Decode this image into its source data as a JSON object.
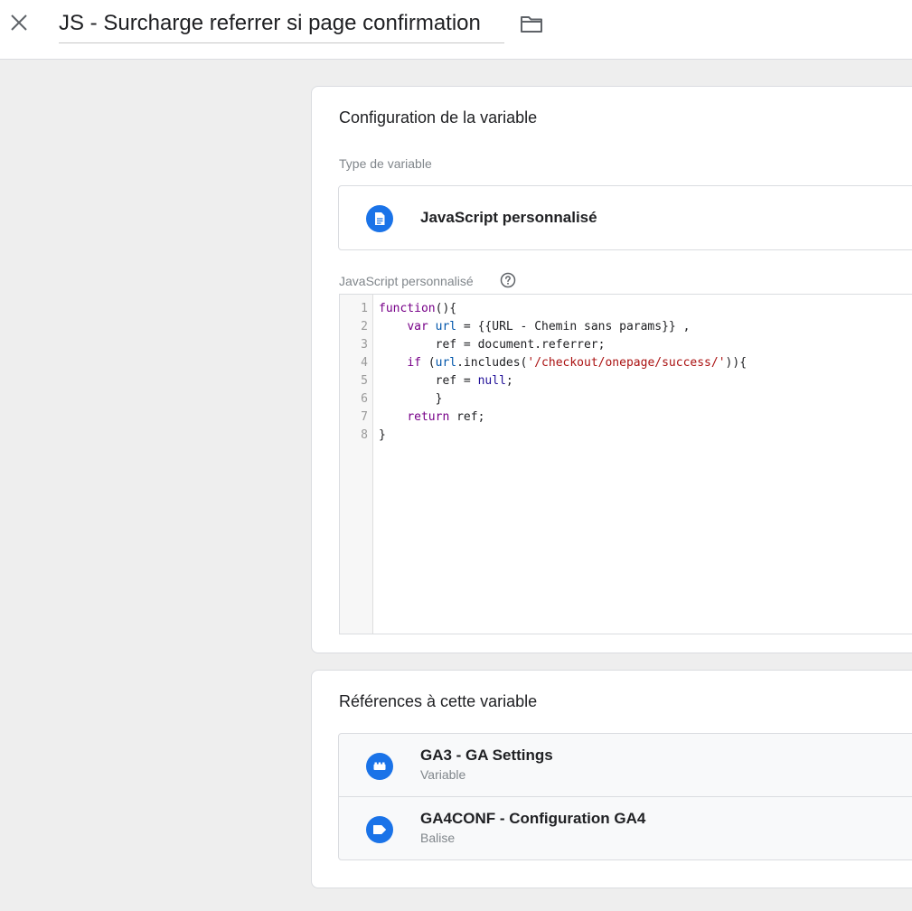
{
  "header": {
    "title": "JS - Surcharge referrer si page confirmation"
  },
  "config": {
    "heading": "Configuration de la variable",
    "type_label": "Type de variable",
    "type_value": "JavaScript personnalisé",
    "code_label": "JavaScript personnalisé",
    "line_numbers": [
      "1",
      "2",
      "3",
      "4",
      "5",
      "6",
      "7",
      "8"
    ],
    "code": {
      "l1": {
        "fn": "function",
        "rest": "(){"
      },
      "l2": {
        "indent": "    ",
        "kw": "var",
        "sp": " ",
        "var": "url",
        "rest": " = {{URL - Chemin sans params}} ,"
      },
      "l3": {
        "indent": "        ",
        "rest": "ref = document.referrer;"
      },
      "l4": {
        "indent": "    ",
        "kw": "if",
        "open": " (",
        "var": "url",
        "mid": ".includes(",
        "str": "'/checkout/onepage/success/'",
        "close": ")){"
      },
      "l5": {
        "indent": "        ",
        "pre": "ref = ",
        "atom": "null",
        "rest": ";"
      },
      "l6": {
        "indent": "        ",
        "rest": "}"
      },
      "l7": {
        "indent": "    ",
        "kw": "return",
        "rest": " ref;"
      },
      "l8": {
        "rest": "}"
      }
    }
  },
  "references": {
    "heading": "Références à cette variable",
    "items": [
      {
        "name": "GA3 - GA Settings",
        "type": "Variable",
        "icon": "variable-icon"
      },
      {
        "name": "GA4CONF - Configuration GA4",
        "type": "Balise",
        "icon": "tag-icon"
      }
    ]
  },
  "colors": {
    "accent": "#1a73e8",
    "keyword": "#770088",
    "variable": "#0055aa",
    "string": "#aa1111",
    "atom": "#221199"
  }
}
